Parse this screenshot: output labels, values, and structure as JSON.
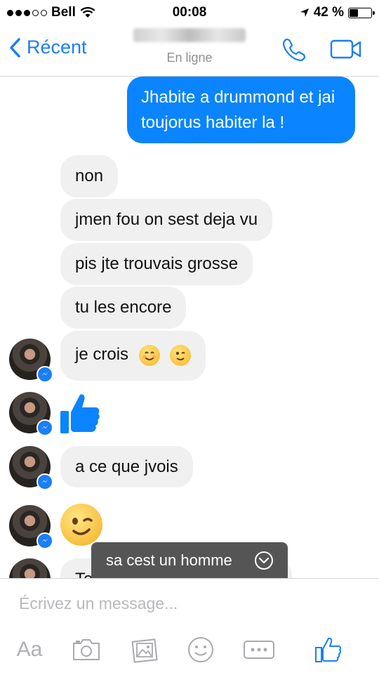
{
  "status_bar": {
    "carrier": "Bell",
    "time": "00:08",
    "battery_text": "42 %",
    "battery_level": 0.42
  },
  "nav": {
    "back_label": "Récent",
    "presence": "En ligne",
    "call_icon": "phone-icon",
    "video_icon": "video-camera-icon"
  },
  "messages": {
    "outgoing_1": "Jhabite a drummond et jai toujorus habiter la !",
    "incoming": [
      "non",
      "jmen fou on sest deja vu",
      "pis jte trouvais grosse",
      "tu les encore",
      "je crois",
      "a ce que jvois",
      "Te"
    ],
    "emoji": [
      "smiling-face-icon",
      "winking-face-icon",
      "thumbs-up-icon",
      "winking-face-icon"
    ]
  },
  "toast": {
    "text": "sa cest un homme"
  },
  "composer": {
    "placeholder": "Écrivez un message...",
    "aa_label": "Aa"
  },
  "colors": {
    "accent": "#1a7ef5",
    "outgoing_bubble": "#0a84ff",
    "incoming_bubble": "#f0f0f0",
    "toast": "#555555"
  }
}
